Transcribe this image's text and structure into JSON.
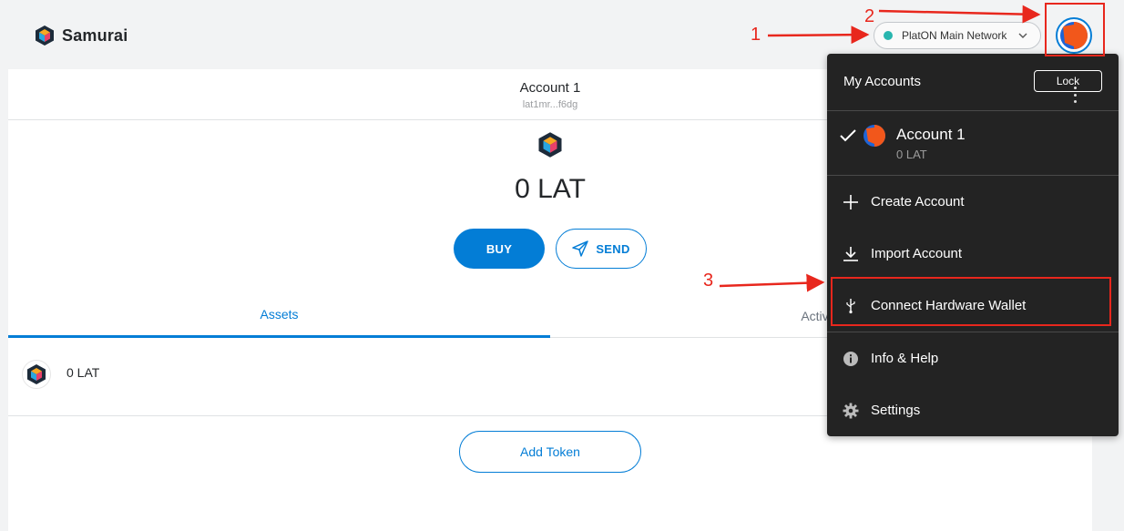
{
  "app": {
    "name": "Samurai"
  },
  "header": {
    "network_label": "PlatON Main Network",
    "network_dot_color": "#29b6af"
  },
  "account_bar": {
    "name": "Account 1",
    "address": "lat1mr...f6dg"
  },
  "balance": {
    "text": "0 LAT"
  },
  "actions": {
    "buy_label": "BUY",
    "send_label": "SEND"
  },
  "tabs": [
    {
      "label": "Assets",
      "active": true
    },
    {
      "label": "Activity",
      "active": false
    }
  ],
  "assets": [
    {
      "label": "0 LAT"
    }
  ],
  "add_token_label": "Add Token",
  "menu": {
    "title": "My Accounts",
    "lock_label": "Lock",
    "accounts": [
      {
        "name": "Account 1",
        "balance": "0 LAT",
        "selected": true
      }
    ],
    "items": [
      {
        "label": "Create Account",
        "icon": "plus-icon"
      },
      {
        "label": "Import Account",
        "icon": "download-icon"
      },
      {
        "label": "Connect Hardware Wallet",
        "icon": "usb-icon"
      },
      {
        "label": "Info & Help",
        "icon": "info-icon"
      },
      {
        "label": "Settings",
        "icon": "gear-icon"
      }
    ]
  },
  "annotations": [
    {
      "label": "1"
    },
    {
      "label": "2"
    },
    {
      "label": "3"
    }
  ],
  "colors": {
    "accent": "#037dd6",
    "menu_bg": "#232323",
    "annotation_red": "#e8271d",
    "avatar_orange": "#f2571b",
    "avatar_blue": "#1e64d6"
  }
}
